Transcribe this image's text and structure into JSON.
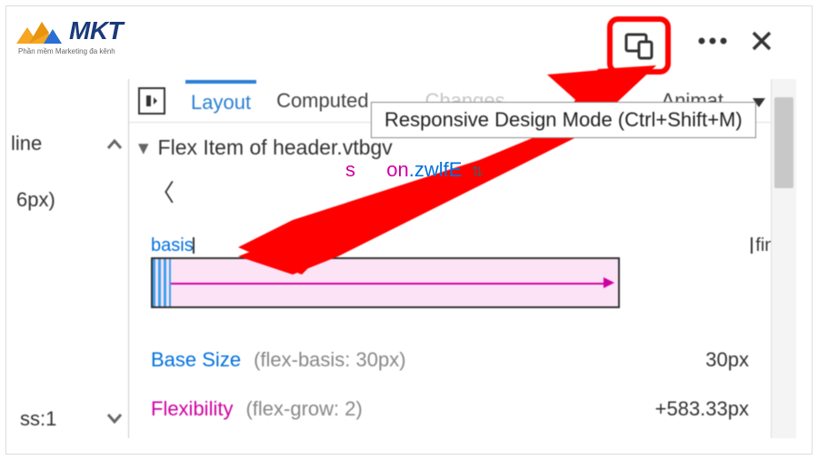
{
  "logo": {
    "text": "MKT",
    "sub": "Phần mềm Marketing đa kênh"
  },
  "tooltip": "Responsive Design Mode (Ctrl+Shift+M)",
  "left_panel": {
    "line": "line",
    "px": "6px)",
    "ss": "ss:1"
  },
  "tabs": {
    "layout": "Layout",
    "computed": "Computed",
    "changes": "Changes",
    "animat": "Animat"
  },
  "section": {
    "title": "Flex Item of header.vtbgv"
  },
  "crumb": {
    "tag_prefix": "section",
    "class": ".zwlfE"
  },
  "diagram": {
    "basis": "basis",
    "final": "final"
  },
  "rows": {
    "base": {
      "name": "Base Size",
      "note": "(flex-basis: 30px)",
      "val": "30px"
    },
    "flex": {
      "name": "Flexibility",
      "note": "(flex-grow: 2)",
      "val": "+583.33px"
    }
  }
}
